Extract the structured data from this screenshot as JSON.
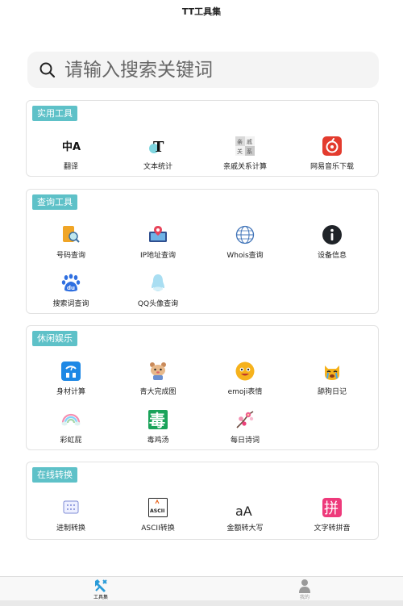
{
  "app": {
    "title": "TT工具集"
  },
  "search": {
    "placeholder": "请输入搜索关键词"
  },
  "sections": [
    {
      "tag": "实用工具",
      "items": [
        {
          "label": "翻译",
          "icon": "translate-icon"
        },
        {
          "label": "文本统计",
          "icon": "text-icon"
        },
        {
          "label": "亲戚关系计算",
          "icon": "relatives-icon"
        },
        {
          "label": "网易音乐下载",
          "icon": "netease-music-icon"
        }
      ]
    },
    {
      "tag": "查询工具",
      "items": [
        {
          "label": "号码查询",
          "icon": "number-search-icon"
        },
        {
          "label": "IP地址查询",
          "icon": "ip-location-icon"
        },
        {
          "label": "Whois查询",
          "icon": "globe-icon"
        },
        {
          "label": "设备信息",
          "icon": "info-icon"
        },
        {
          "label": "搜索词查询",
          "icon": "baidu-icon"
        },
        {
          "label": "QQ头像查询",
          "icon": "qq-penguin-icon"
        }
      ]
    },
    {
      "tag": "休闲娱乐",
      "items": [
        {
          "label": "身材计算",
          "icon": "scale-icon"
        },
        {
          "label": "青大完成图",
          "icon": "hamster-icon"
        },
        {
          "label": "emoji表情",
          "icon": "emoji-icon"
        },
        {
          "label": "舔狗日记",
          "icon": "crying-cat-icon"
        },
        {
          "label": "彩虹屁",
          "icon": "rainbow-icon"
        },
        {
          "label": "毒鸡汤",
          "icon": "poison-icon"
        },
        {
          "label": "每日诗词",
          "icon": "plum-blossom-icon"
        }
      ]
    },
    {
      "tag": "在线转换",
      "items": [
        {
          "label": "进制转换",
          "icon": "binary-icon"
        },
        {
          "label": "ASCII转换",
          "icon": "ascii-icon"
        },
        {
          "label": "金额转大写",
          "icon": "letter-a-icon"
        },
        {
          "label": "文字转拼音",
          "icon": "pinyin-icon"
        }
      ]
    }
  ],
  "icon_glyphs": {
    "relatives": [
      "亲",
      "戚",
      "关",
      "系"
    ],
    "poison": "毒",
    "pinyin": "拼",
    "ascii": "ASCII",
    "text": "T",
    "translate": "中A",
    "baidu": "du",
    "letter_a": "aA"
  },
  "tabbar": [
    {
      "label": "工具集",
      "icon": "wrench-tools-icon",
      "active": true
    },
    {
      "label": "我的",
      "icon": "user-icon",
      "active": false
    }
  ],
  "colors": {
    "tag_bg": "#5ec1c8",
    "netease_red": "#e33b2e",
    "info_dark": "#1f2328",
    "poison_green": "#1aa35a",
    "pinyin_pink": "#ee3a7b"
  }
}
